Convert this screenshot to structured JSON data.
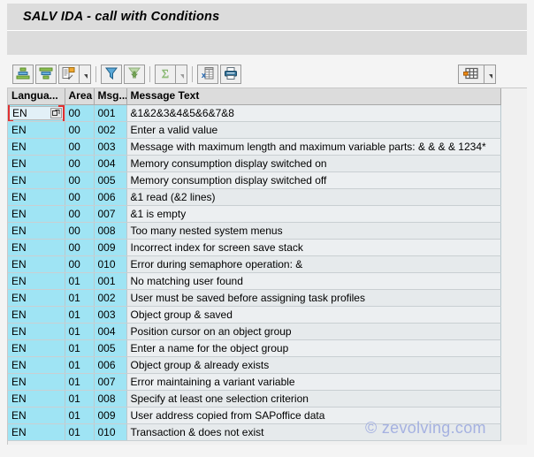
{
  "window": {
    "title": "SALV IDA - call with Conditions"
  },
  "toolbar": {
    "buttons": [
      {
        "name": "sort-ascending-button",
        "icon": "sort-ascending-icon",
        "label": "Sort in Ascending Order"
      },
      {
        "name": "sort-descending-button",
        "icon": "sort-descending-icon",
        "label": "Sort in Descending Order"
      },
      {
        "name": "find-button",
        "icon": "find-icon",
        "label": "Find"
      },
      {
        "name": "find-dropdown",
        "icon": "chevron-down-icon",
        "label": "More Find Options"
      },
      {
        "name": "set-filter-button",
        "icon": "filter-icon",
        "label": "Set Filter"
      },
      {
        "name": "delete-filter-button",
        "icon": "filter-off-icon",
        "label": "Delete Filter"
      },
      {
        "name": "total-button",
        "icon": "sigma-icon",
        "label": "Total"
      },
      {
        "name": "total-dropdown",
        "icon": "chevron-down-icon",
        "label": "Subtotals"
      },
      {
        "name": "export-spreadsheet-button",
        "icon": "excel-export-icon",
        "label": "Export to Spreadsheet"
      },
      {
        "name": "print-button",
        "icon": "printer-icon",
        "label": "Print"
      },
      {
        "name": "layout-button",
        "icon": "layout-grid-icon",
        "label": "Select Layout"
      },
      {
        "name": "layout-dropdown",
        "icon": "chevron-down-icon",
        "label": "More Layout Options"
      }
    ]
  },
  "grid": {
    "columns": [
      {
        "key": "lang",
        "label": "Langua..."
      },
      {
        "key": "area",
        "label": "Area"
      },
      {
        "key": "msg",
        "label": "Msg..."
      },
      {
        "key": "text",
        "label": "Message Text"
      }
    ],
    "selected_cell": {
      "row": 0,
      "column": "lang",
      "value": "EN"
    },
    "rows": [
      {
        "lang": "EN",
        "area": "00",
        "msg": "001",
        "text": "&1&2&3&4&5&6&7&8"
      },
      {
        "lang": "EN",
        "area": "00",
        "msg": "002",
        "text": "Enter a valid value"
      },
      {
        "lang": "EN",
        "area": "00",
        "msg": "003",
        "text": "Message with maximum length and maximum variable parts: & & & & 1234*"
      },
      {
        "lang": "EN",
        "area": "00",
        "msg": "004",
        "text": "Memory consumption display switched on"
      },
      {
        "lang": "EN",
        "area": "00",
        "msg": "005",
        "text": "Memory consumption display switched off"
      },
      {
        "lang": "EN",
        "area": "00",
        "msg": "006",
        "text": "&1 read (&2 lines)"
      },
      {
        "lang": "EN",
        "area": "00",
        "msg": "007",
        "text": "&1 is empty"
      },
      {
        "lang": "EN",
        "area": "00",
        "msg": "008",
        "text": "Too many nested system menus"
      },
      {
        "lang": "EN",
        "area": "00",
        "msg": "009",
        "text": "Incorrect index for screen save stack"
      },
      {
        "lang": "EN",
        "area": "00",
        "msg": "010",
        "text": "Error during semaphore operation: &"
      },
      {
        "lang": "EN",
        "area": "01",
        "msg": "001",
        "text": "No matching user found"
      },
      {
        "lang": "EN",
        "area": "01",
        "msg": "002",
        "text": "User must be saved before assigning task profiles"
      },
      {
        "lang": "EN",
        "area": "01",
        "msg": "003",
        "text": "Object group & saved"
      },
      {
        "lang": "EN",
        "area": "01",
        "msg": "004",
        "text": "Position cursor on an object group"
      },
      {
        "lang": "EN",
        "area": "01",
        "msg": "005",
        "text": "Enter a name for the object group"
      },
      {
        "lang": "EN",
        "area": "01",
        "msg": "006",
        "text": "Object group & already exists"
      },
      {
        "lang": "EN",
        "area": "01",
        "msg": "007",
        "text": "Error maintaining a variant variable"
      },
      {
        "lang": "EN",
        "area": "01",
        "msg": "008",
        "text": "Specify at least one selection criterion"
      },
      {
        "lang": "EN",
        "area": "01",
        "msg": "009",
        "text": "User address copied from SAPoffice data"
      },
      {
        "lang": "EN",
        "area": "01",
        "msg": "010",
        "text": "Transaction & does not exist"
      }
    ]
  },
  "watermark": {
    "text": "© zevolving.com"
  },
  "colors": {
    "key_column": "#9fe4f4",
    "header": "#dcdcdc",
    "row": "#eceff1",
    "row_alt": "#e6eaec",
    "focus": "#e03030",
    "watermark": "#9aa8e0"
  }
}
